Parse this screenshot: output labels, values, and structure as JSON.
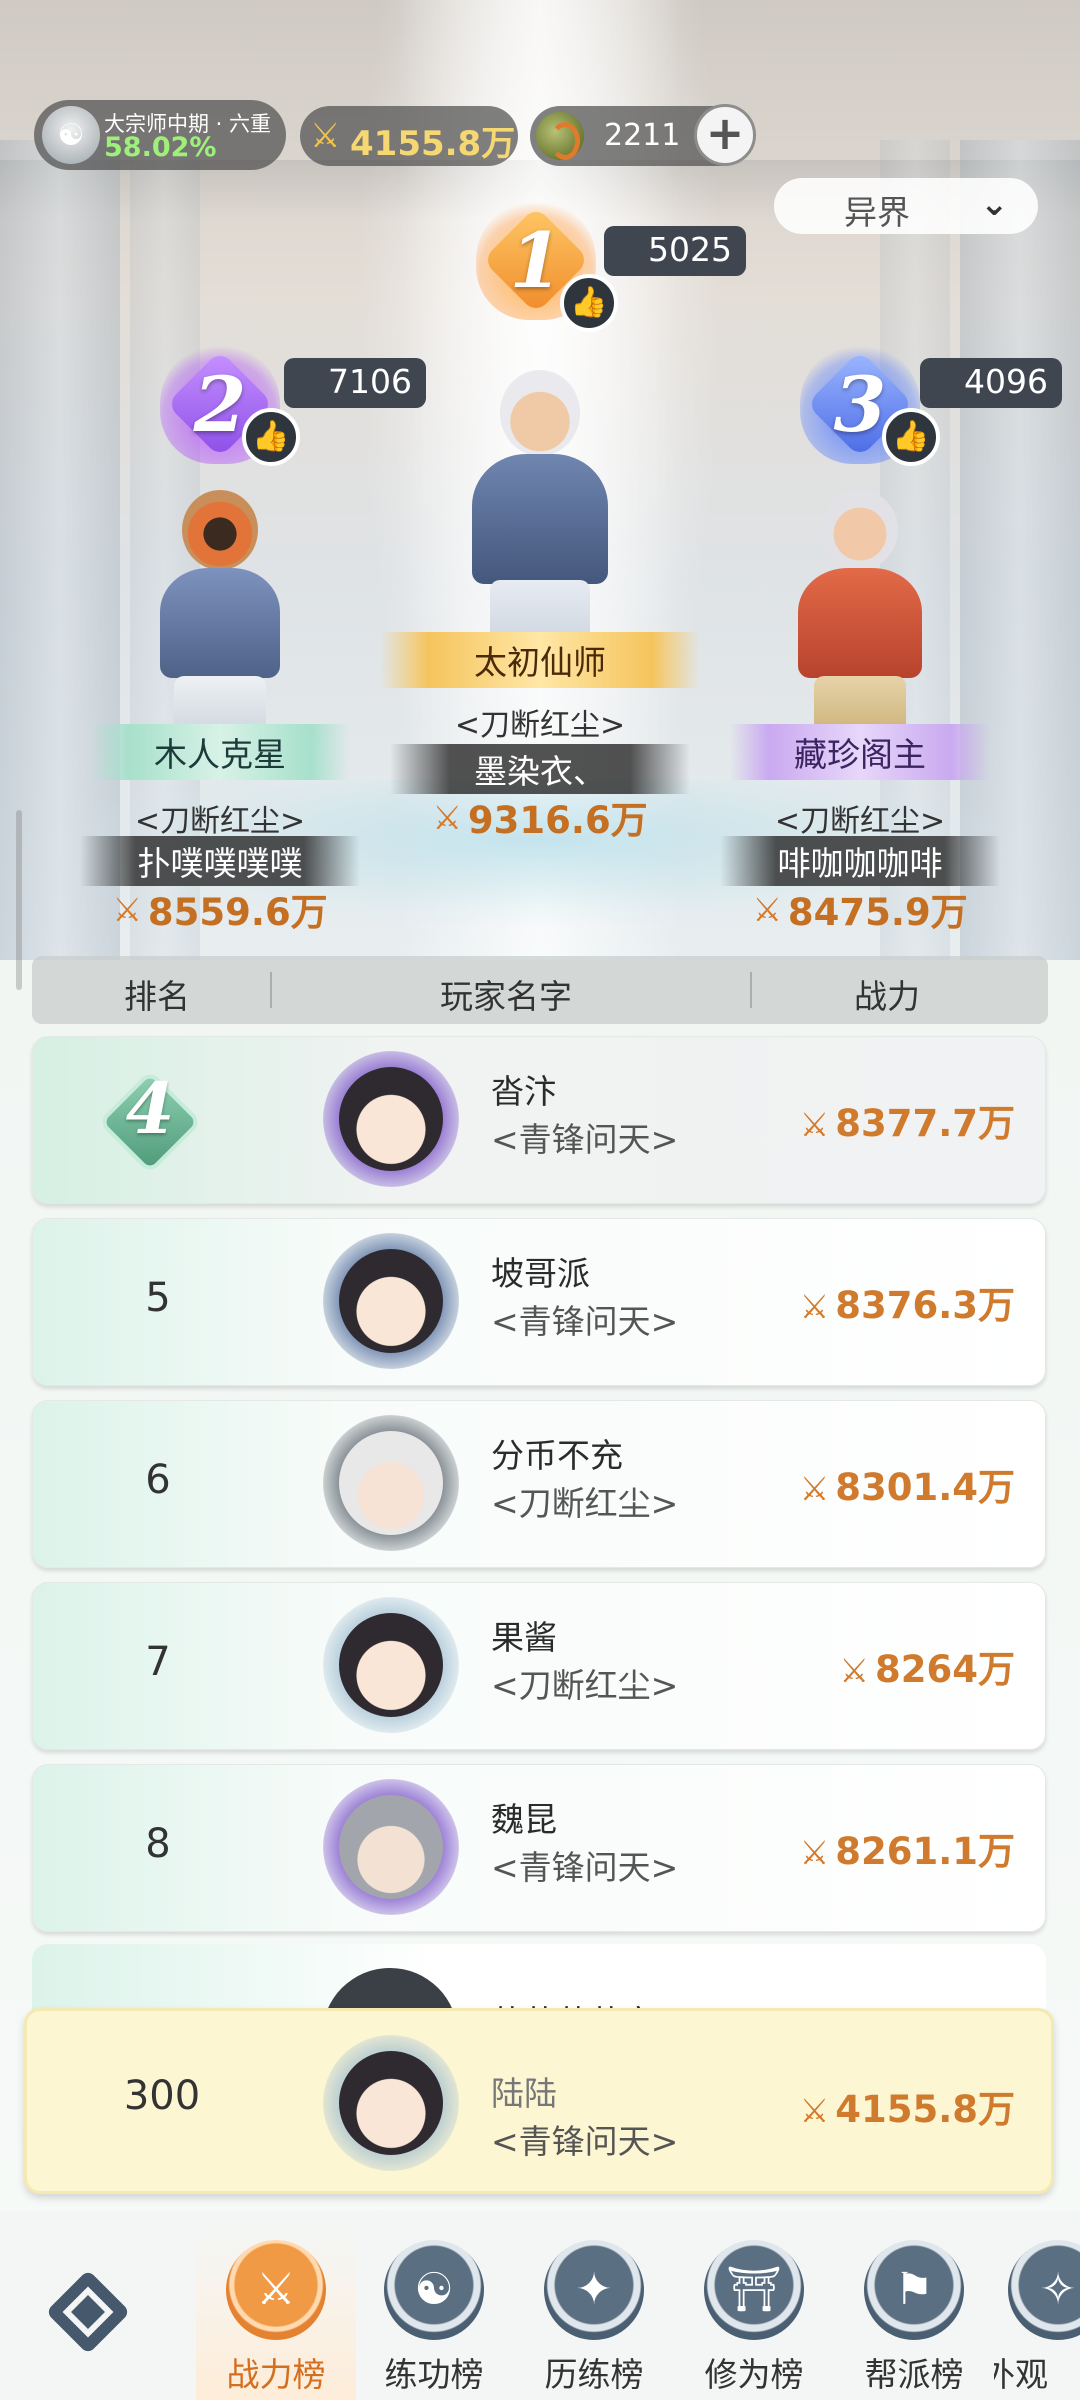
{
  "header": {
    "realm_title": "大宗师中期 · 六重",
    "realm_progress": "58.02%",
    "power": "4155.8万",
    "currency": "2211",
    "add_label": "+",
    "server_select": "异界"
  },
  "podium": [
    {
      "rank": "1",
      "likes": "5025",
      "title": "太初仙师",
      "guild": "<刀断红尘>",
      "name": "墨染衣、",
      "power": "9316.6万"
    },
    {
      "rank": "2",
      "likes": "7106",
      "title": "木人克星",
      "guild": "<刀断红尘>",
      "name": "扑噗噗噗噗",
      "power": "8559.6万"
    },
    {
      "rank": "3",
      "likes": "4096",
      "title": "藏珍阁主",
      "guild": "<刀断红尘>",
      "name": "啡咖咖咖啡",
      "power": "8475.9万"
    }
  ],
  "table_header": {
    "rank": "排名",
    "player": "玩家名字",
    "power": "战力"
  },
  "ranking": [
    {
      "rank": "4",
      "name": "沓汴",
      "guild": "<青锋问天>",
      "power": "8377.7万"
    },
    {
      "rank": "5",
      "name": "坡哥派",
      "guild": "<青锋问天>",
      "power": "8376.3万"
    },
    {
      "rank": "6",
      "name": "分币不充",
      "guild": "<刀断红尘>",
      "power": "8301.4万"
    },
    {
      "rank": "7",
      "name": "果酱",
      "guild": "<刀断红尘>",
      "power": "8264万"
    },
    {
      "rank": "8",
      "name": "魏昆",
      "guild": "<青锋问天>",
      "power": "8261.1万"
    },
    {
      "name": "苦苦苦苦寒"
    }
  ],
  "my_rank": {
    "rank": "300",
    "name": "陆陆",
    "guild": "<青锋问天>",
    "power": "4155.8万"
  },
  "tabs": [
    {
      "label": "战力榜",
      "active": true
    },
    {
      "label": "练功榜"
    },
    {
      "label": "历练榜"
    },
    {
      "label": "修为榜"
    },
    {
      "label": "帮派榜"
    },
    {
      "label": "外观"
    }
  ],
  "icons": {
    "power": "crossed-swords-icon",
    "like": "thumbs-up-icon",
    "dropdown": "chevron-down-icon",
    "home": "diamond-grid-icon"
  },
  "colors": {
    "accent": "#d46f1f",
    "power_text": "#cf7a2c",
    "progress_text": "#9ef07a"
  }
}
